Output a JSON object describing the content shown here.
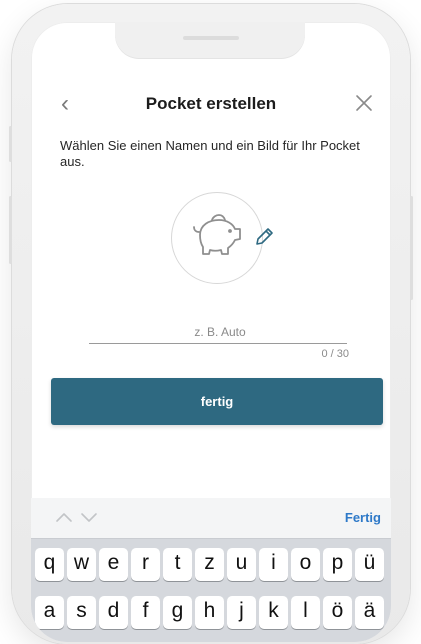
{
  "header": {
    "title": "Pocket erstellen"
  },
  "instructions": "Wählen Sie einen Namen und ein Bild für Ihr Pocket aus.",
  "name_input": {
    "value": "",
    "placeholder": "z. B. Auto"
  },
  "counter": "0 / 30",
  "primary_button": "fertig",
  "keyboard": {
    "done_label": "Fertig",
    "row1": [
      "q",
      "w",
      "e",
      "r",
      "t",
      "z",
      "u",
      "i",
      "o",
      "p",
      "ü"
    ],
    "row2": [
      "a",
      "s",
      "d",
      "f",
      "g",
      "h",
      "j",
      "k",
      "l",
      "ö",
      "ä"
    ]
  },
  "colors": {
    "accent": "#2e6981",
    "keyboard_done": "#2e79c8"
  },
  "icons": {
    "back": "chevron-left-icon",
    "close": "close-icon",
    "avatar": "piggy-bank-icon",
    "edit": "pencil-icon",
    "prev": "chevron-up-icon",
    "next": "chevron-down-icon"
  }
}
